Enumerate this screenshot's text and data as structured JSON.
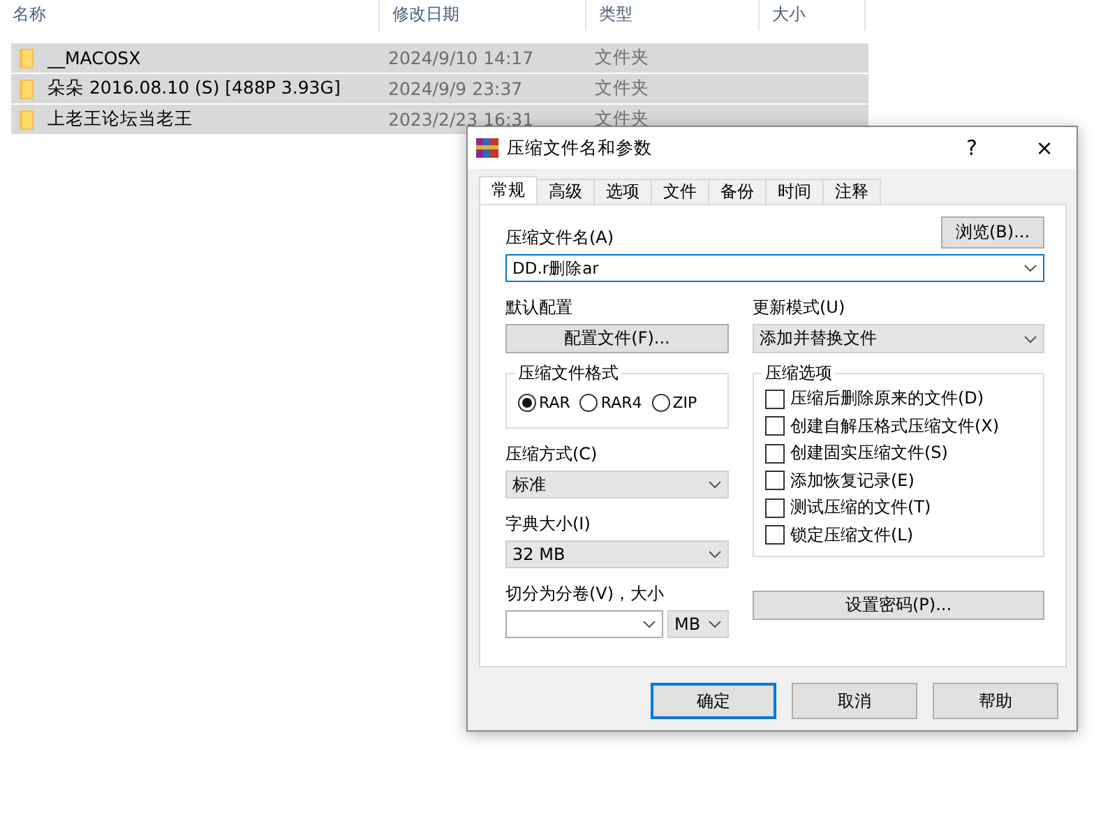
{
  "explorer": {
    "columns": [
      "名称",
      "修改日期",
      "类型",
      "大小"
    ],
    "rows": [
      {
        "name": "__MACOSX",
        "date": "2024/9/10 14:17",
        "type": "文件夹",
        "selected": true
      },
      {
        "name": "朵朵 2016.08.10  (S) [488P 3.93G]",
        "date": "2024/9/9 23:37",
        "type": "文件夹",
        "selected": true
      },
      {
        "name": "上老王论坛当老王",
        "date": "2023/2/23 16:31",
        "type": "文件夹",
        "selected": true
      }
    ]
  },
  "dialog": {
    "title": "压缩文件名和参数",
    "help": "?",
    "close": "×",
    "tabs": [
      {
        "label": "常规",
        "selected": true
      },
      {
        "label": "高级",
        "selected": false
      },
      {
        "label": "选项",
        "selected": false
      },
      {
        "label": "文件",
        "selected": false
      },
      {
        "label": "备份",
        "selected": false
      },
      {
        "label": "时间",
        "selected": false
      },
      {
        "label": "注释",
        "selected": false
      }
    ],
    "archive_name": {
      "label": "压缩文件名(A)",
      "value": "DD.r删除ar"
    },
    "browse": "浏览(B)...",
    "default_profile": {
      "label": "默认配置",
      "button": "配置文件(F)..."
    },
    "update_mode": {
      "label": "更新模式(U)",
      "value": "添加并替换文件"
    },
    "archive_format": {
      "label": "压缩文件格式",
      "options": [
        {
          "label": "RAR",
          "selected": true
        },
        {
          "label": "RAR4",
          "selected": false
        },
        {
          "label": "ZIP",
          "selected": false
        }
      ]
    },
    "compression_method": {
      "label": "压缩方式(C)",
      "value": "标准"
    },
    "dictionary_size": {
      "label": "字典大小(I)",
      "value": "32 MB"
    },
    "split_volumes": {
      "label": "切分为分卷(V)，大小",
      "unit": "MB"
    },
    "archive_options": {
      "label": "压缩选项",
      "items": [
        {
          "label": "压缩后删除原来的文件(D)",
          "checked": false
        },
        {
          "label": "创建自解压格式压缩文件(X)",
          "checked": false
        },
        {
          "label": "创建固实压缩文件(S)",
          "checked": false
        },
        {
          "label": "添加恢复记录(E)",
          "checked": false
        },
        {
          "label": "测试压缩的文件(T)",
          "checked": false
        },
        {
          "label": "锁定压缩文件(L)",
          "checked": false
        }
      ]
    },
    "set_password": "设置密码(P)...",
    "buttons": [
      {
        "label": "确定",
        "default": true
      },
      {
        "label": "取消",
        "default": false
      },
      {
        "label": "帮助",
        "default": false
      }
    ]
  }
}
